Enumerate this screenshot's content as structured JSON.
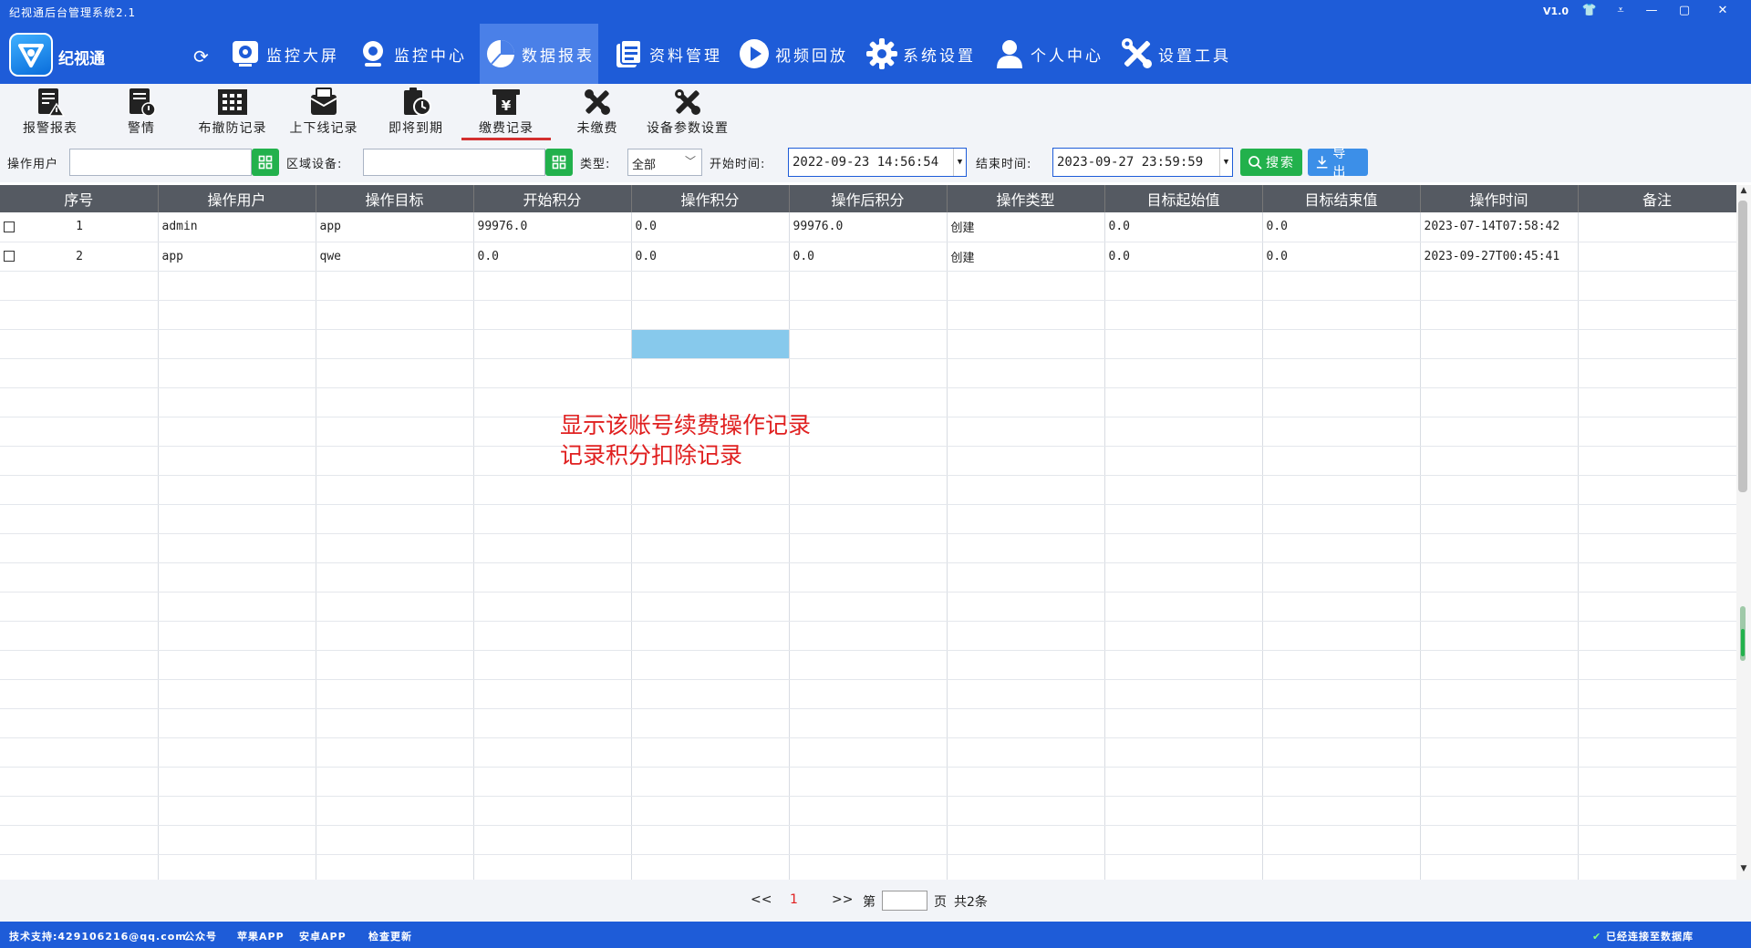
{
  "window": {
    "title": "纪视通后台管理系统2.1",
    "version": "V1.0"
  },
  "brand": {
    "name": "纪视通"
  },
  "nav": {
    "items": [
      {
        "label": "监控大屏",
        "icon": "monitor-screen-icon"
      },
      {
        "label": "监控中心",
        "icon": "webcam-icon"
      },
      {
        "label": "数据报表",
        "icon": "pie-chart-icon",
        "active": true
      },
      {
        "label": "资料管理",
        "icon": "document-list-icon"
      },
      {
        "label": "视频回放",
        "icon": "play-icon"
      },
      {
        "label": "系统设置",
        "icon": "gear-icon"
      },
      {
        "label": "个人中心",
        "icon": "user-icon"
      },
      {
        "label": "设置工具",
        "icon": "tools-icon"
      }
    ]
  },
  "subnav": {
    "items": [
      {
        "label": "报警报表",
        "icon": "alarm-report-icon"
      },
      {
        "label": "警情",
        "icon": "alert-doc-icon"
      },
      {
        "label": "布撤防记录",
        "icon": "arm-disarm-icon"
      },
      {
        "label": "上下线记录",
        "icon": "online-offline-icon"
      },
      {
        "label": "即将到期",
        "icon": "expiring-icon"
      },
      {
        "label": "缴费记录",
        "icon": "payment-record-icon",
        "active": true
      },
      {
        "label": "未缴费",
        "icon": "unpaid-icon"
      },
      {
        "label": "设备参数设置",
        "icon": "device-params-icon"
      }
    ]
  },
  "filters": {
    "operator_label": "操作用户",
    "operator_value": "",
    "area_label": "区域设备:",
    "area_value": "",
    "type_label": "类型:",
    "type_value": "全部",
    "start_label": "开始时间:",
    "start_value": "2022-09-23 14:56:54",
    "end_label": "结束时间:",
    "end_value": "2023-09-27 23:59:59",
    "search_label": "搜索",
    "export_label": "导出"
  },
  "table": {
    "columns": [
      "序号",
      "操作用户",
      "操作目标",
      "开始积分",
      "操作积分",
      "操作后积分",
      "操作类型",
      "目标起始值",
      "目标结束值",
      "操作时间",
      "备注"
    ],
    "rows": [
      {
        "index": "1",
        "user": "admin",
        "target": "app",
        "start_points": "99976.0",
        "op_points": "0.0",
        "after_points": "99976.0",
        "op_type": "创建",
        "target_start": "0.0",
        "target_end": "0.0",
        "op_time": "2023-07-14T07:58:42",
        "remark": ""
      },
      {
        "index": "2",
        "user": "app",
        "target": "qwe",
        "start_points": "0.0",
        "op_points": "0.0",
        "after_points": "0.0",
        "op_type": "创建",
        "target_start": "0.0",
        "target_end": "0.0",
        "op_time": "2023-09-27T00:45:41",
        "remark": ""
      }
    ]
  },
  "annotation": {
    "line1": "显示该账号续费操作记录",
    "line2": "记录积分扣除记录"
  },
  "pager": {
    "prev": "<<",
    "current": "1",
    "next": ">>",
    "page_prefix": "第",
    "page_suffix": "页",
    "total": "共2条"
  },
  "status": {
    "support": "技术支持:429106216@qq.com",
    "wechat": "公众号",
    "apple_app": "苹果APP",
    "android_app": "安卓APP",
    "check_update": "检查更新",
    "db_status": "已经连接至数据库"
  },
  "colors": {
    "primary": "#1e5cd8",
    "success": "#22b14c",
    "danger": "#e02020",
    "header": "#555a62"
  }
}
